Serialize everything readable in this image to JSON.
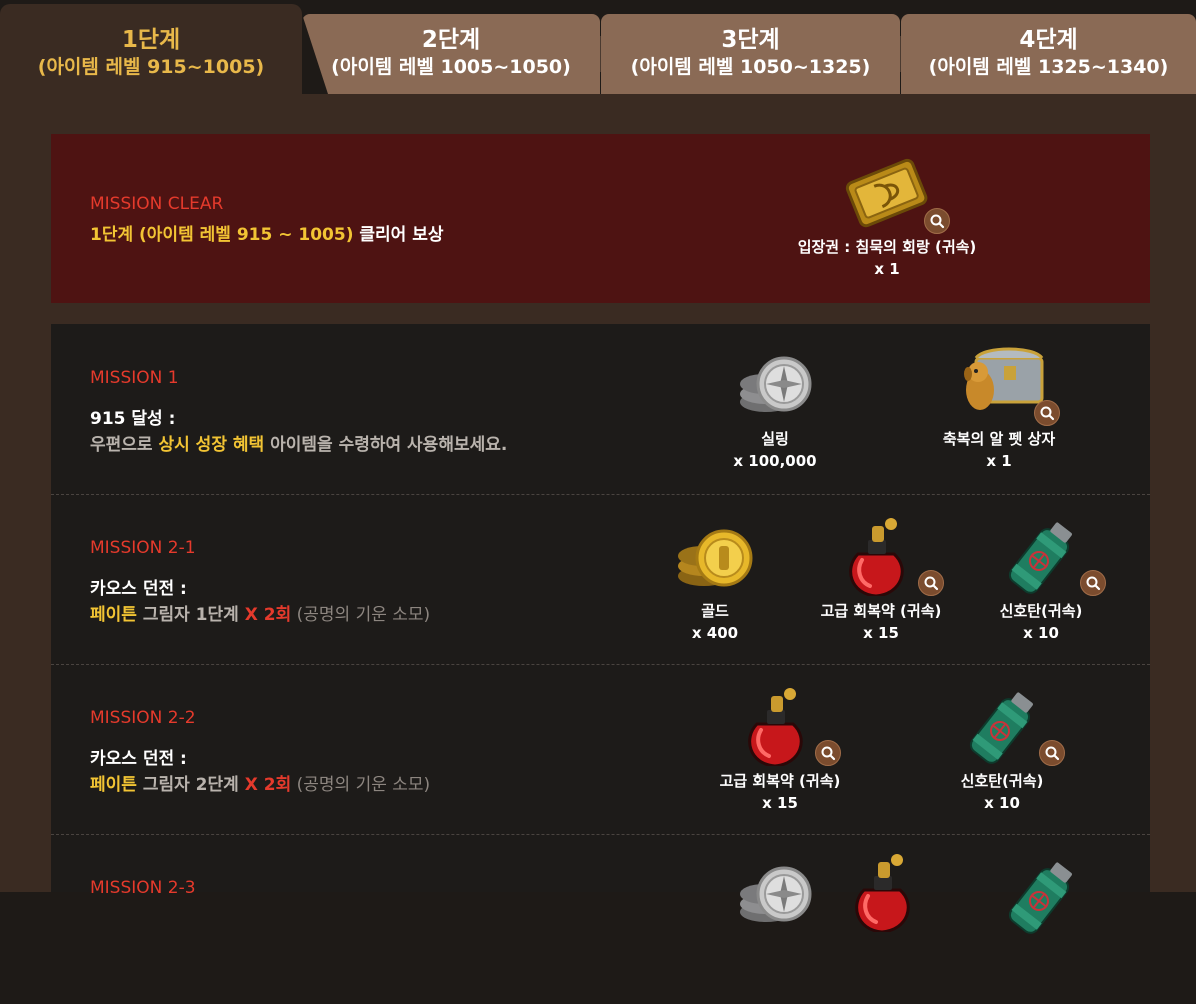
{
  "tabs": [
    {
      "label": "1단계",
      "range": "(아이템 레벨 915~1005)"
    },
    {
      "label": "2단계",
      "range": "(아이템 레벨 1005~1050)"
    },
    {
      "label": "3단계",
      "range": "(아이템 레벨 1050~1325)"
    },
    {
      "label": "4단계",
      "range": "(아이템 레벨 1325~1340)"
    }
  ],
  "clear": {
    "title": "MISSION CLEAR",
    "desc_highlight": "1단계 (아이템 레벨 915 ~ 1005)",
    "desc_rest": " 클리어 보상",
    "reward": {
      "name": "입장권 : 침묵의 회랑 (귀속)",
      "qty": "x 1",
      "icon": "ticket-icon"
    }
  },
  "missions": [
    {
      "title": "MISSION 1",
      "line1": "915 달성 :",
      "line2_a": "우편으로 ",
      "line2_b": "상시 성장 혜택",
      "line2_c": " 아이템을 수령하여 사용해보세요.",
      "rewards": [
        {
          "name": "실링",
          "qty": "x 100,000",
          "icon": "silver-coin-icon"
        },
        {
          "name": "축복의 알 펫 상자",
          "qty": "x 1",
          "icon": "pet-box-icon"
        }
      ]
    },
    {
      "title": "MISSION 2-1",
      "line1": "카오스 던전 :",
      "line2_a": "페이튼",
      "line2_b": " 그림자 1단계 ",
      "line2_c": "X 2회",
      "line2_d": " (공명의 기운 소모)",
      "rewards": [
        {
          "name": "골드",
          "qty": "x 400",
          "icon": "gold-coin-icon"
        },
        {
          "name": "고급 회복약 (귀속)",
          "qty": "x 15",
          "icon": "potion-icon"
        },
        {
          "name": "신호탄(귀속)",
          "qty": "x 10",
          "icon": "flare-icon"
        }
      ]
    },
    {
      "title": "MISSION 2-2",
      "line1": "카오스 던전 :",
      "line2_a": "페이튼",
      "line2_b": " 그림자 2단계 ",
      "line2_c": "X 2회",
      "line2_d": " (공명의 기운 소모)",
      "rewards": [
        {
          "name": "고급 회복약 (귀속)",
          "qty": "x 15",
          "icon": "potion-icon"
        },
        {
          "name": "신호탄(귀속)",
          "qty": "x 10",
          "icon": "flare-icon"
        }
      ]
    },
    {
      "title": "MISSION 2-3"
    }
  ],
  "colors": {
    "accent_gold": "#e8b84a",
    "mission_red": "#e53a2c",
    "highlight_yellow": "#f2c434"
  }
}
